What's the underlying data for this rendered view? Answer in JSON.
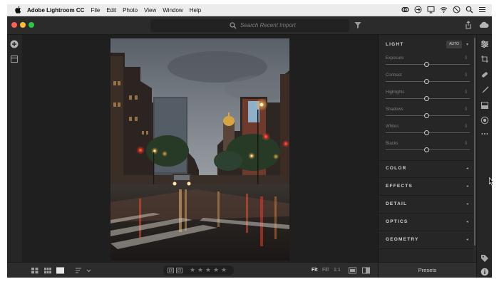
{
  "menubar": {
    "app_name": "Adobe Lightroom CC",
    "items": [
      "File",
      "Edit",
      "Photo",
      "View",
      "Window",
      "Help"
    ]
  },
  "toolbar": {
    "search_placeholder": "Search Recent Import"
  },
  "edit_panel": {
    "light": {
      "title": "LIGHT",
      "auto_label": "AUTO",
      "sliders": [
        {
          "label": "Exposure",
          "value": "0"
        },
        {
          "label": "Contrast",
          "value": "0"
        },
        {
          "label": "Highlights",
          "value": "0"
        },
        {
          "label": "Shadows",
          "value": "0"
        },
        {
          "label": "Whites",
          "value": "0"
        },
        {
          "label": "Blacks",
          "value": "0"
        }
      ]
    },
    "sections": [
      "COLOR",
      "EFFECTS",
      "DETAIL",
      "OPTICS",
      "GEOMETRY"
    ]
  },
  "bottom": {
    "zoom_options": [
      "Fit",
      "Fill",
      "1:1"
    ],
    "active_zoom": "Fit",
    "stars": [
      "★",
      "★",
      "★",
      "★",
      "★"
    ],
    "presets_label": "Presets"
  },
  "colors": {
    "accent_close": "#ff5f57",
    "accent_min": "#febc2e",
    "accent_max": "#28c840",
    "panel_bg": "#262626",
    "canvas_bg": "#1f1f1f"
  }
}
